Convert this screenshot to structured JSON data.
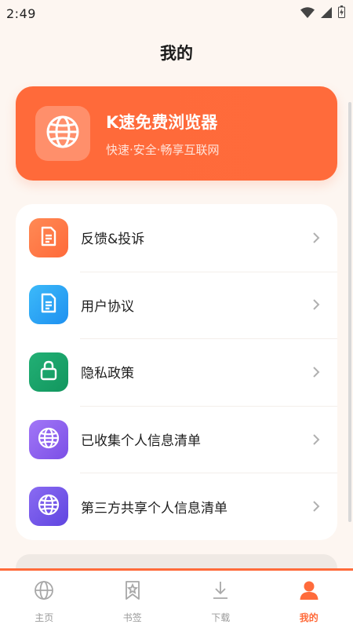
{
  "status_bar": {
    "time": "2:49",
    "icons": [
      "wifi-icon",
      "signal-icon",
      "battery-icon"
    ]
  },
  "header": {
    "title": "我的"
  },
  "hero": {
    "title": "K速免费浏览器",
    "subtitle": "快速·安全·畅享互联网",
    "icon": "globe-icon",
    "color": "#ff6b3b"
  },
  "menu": {
    "items": [
      {
        "label": "反馈&投诉",
        "icon": "document-icon",
        "color": "#ff7a45"
      },
      {
        "label": "用户协议",
        "icon": "document-icon",
        "color": "#2aa5f5"
      },
      {
        "label": "隐私政策",
        "icon": "lock-icon",
        "color": "#18a36a"
      },
      {
        "label": "已收集个人信息清单",
        "icon": "globe-icon",
        "color": "#8a5cf0"
      },
      {
        "label": "第三方共享个人信息清单",
        "icon": "globe-icon",
        "color": "#7657ea"
      }
    ]
  },
  "tabs": [
    {
      "label": "主页",
      "icon": "globe-icon",
      "active": false
    },
    {
      "label": "书签",
      "icon": "bookmark-icon",
      "active": false
    },
    {
      "label": "下载",
      "icon": "download-icon",
      "active": false
    },
    {
      "label": "我的",
      "icon": "user-icon",
      "active": true
    }
  ],
  "colors": {
    "accent": "#ff6b3b",
    "background": "#fdf6f1",
    "inactive_tab": "#9a9a9a"
  }
}
